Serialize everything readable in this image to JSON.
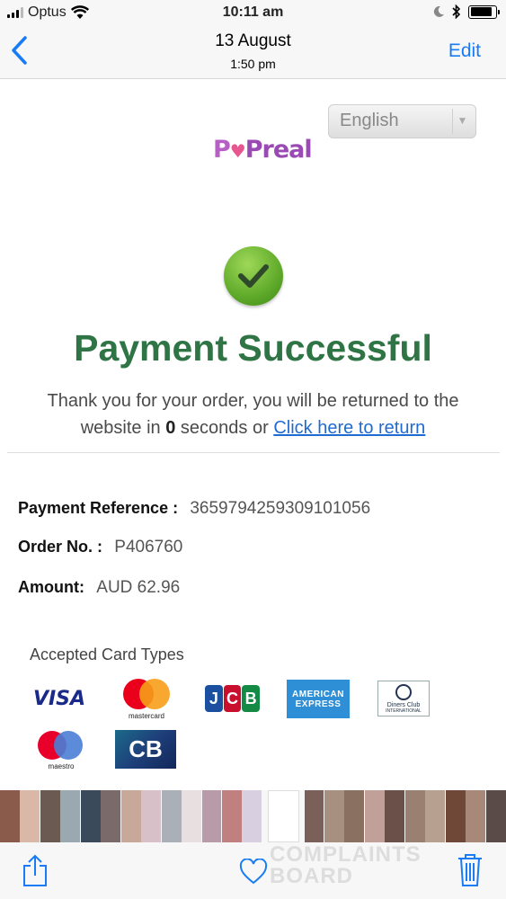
{
  "status_bar": {
    "carrier": "Optus",
    "time": "10:11 am"
  },
  "nav": {
    "title": "13 August",
    "subtitle": "1:50 pm",
    "edit_label": "Edit"
  },
  "page": {
    "language": "English",
    "logo": {
      "p": "P",
      "heart": "♥",
      "rest": "Preal"
    },
    "title": "Payment Successful",
    "message_part1": "Thank you for your order, you will be returned to the",
    "message_part2": "website in",
    "countdown": "0",
    "message_part3": "seconds or",
    "return_link": "Click here to return",
    "details": {
      "payment_reference_label": "Payment Reference :",
      "payment_reference": "3659794259309101056",
      "order_no_label": "Order No. :",
      "order_no": "P406760",
      "amount_label": "Amount:",
      "amount": "AUD 62.96"
    },
    "accepted_title": "Accepted Card Types",
    "cards": {
      "visa": "VISA",
      "mastercard": "mastercard",
      "jcb": [
        "J",
        "C",
        "B"
      ],
      "amex_line1": "AMERICAN",
      "amex_line2": "EXPRESS",
      "diners_line1": "Diners Club",
      "diners_line2": "INTERNATIONAL",
      "maestro": "maestro",
      "cb": "CB"
    }
  },
  "thumbnails": {
    "colors": [
      "#8a5a4a",
      "#d9b8a8",
      "#6a5a52",
      "#9aa8b0",
      "#3a4a5a",
      "#7a6a6a",
      "#c8a898",
      "#d8c0c8",
      "#aab0b8",
      "#e8e0e0",
      "#b89aa8",
      "#c08080",
      "#d8d0e0",
      "selected",
      "#7a6058",
      "#a89080",
      "#8a7060",
      "#c0a098",
      "#6a5048",
      "#9a8070",
      "#b8a090",
      "#704838",
      "#a88878",
      "#5a4a48"
    ]
  },
  "toolbar": {
    "watermark_line1": "COMPLAINTS",
    "watermark_line2": "BOARD"
  },
  "colors": {
    "ios_blue": "#1a7cf5",
    "success_green": "#2e7444",
    "link_blue": "#1f6bd1"
  },
  "icons": {
    "back": "chevron-left-icon",
    "share": "share-icon",
    "favorite": "heart-icon",
    "delete": "trash-icon",
    "wifi": "wifi-icon",
    "moon": "moon-icon",
    "bluetooth": "bluetooth-icon",
    "battery": "battery-icon",
    "success": "checkmark-icon"
  }
}
